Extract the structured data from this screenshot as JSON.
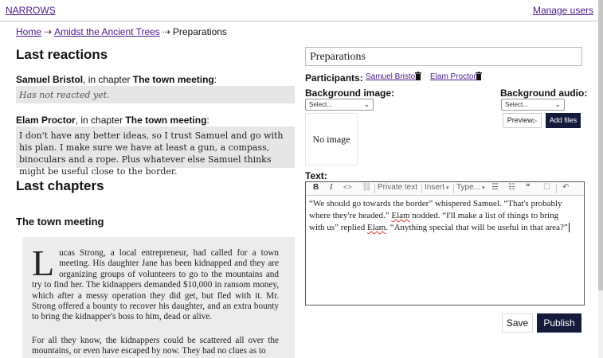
{
  "topbar": {
    "brand": "NARROWS",
    "manage": "Manage users"
  },
  "breadcrumb": {
    "home": "Home",
    "sep": "⇢",
    "story": "Amidst the Ancient Trees",
    "current": "Preparations"
  },
  "reactions": {
    "heading": "Last reactions",
    "items": [
      {
        "name": "Samuel Bristol",
        "mid": ", in chapter ",
        "chapter": "The town meeting",
        "colon": ":",
        "text": "Has not reacted yet."
      },
      {
        "name": "Elam Proctor",
        "mid": ", in chapter ",
        "chapter": "The town meeting",
        "colon": ":",
        "text": "I don't have any better ideas, so I trust Samuel and go with his plan. I make sure we have at least a gun, a compass, binoculars and a rope. Plus whatever else Samuel thinks might be useful close to the border."
      }
    ]
  },
  "chapters": {
    "heading": "Last chapters",
    "title": "The town meeting",
    "dropcap": "L",
    "p1": "ucas Strong, a local entrepreneur, had called for a town meeting. His daughter Jane has been kidnapped and they are organizing groups of volunteers to go to the mountains and try to find her. The kidnappers demanded $10,000 in ransom money, which after a messy operation they did get, but fled with it. Mr. Strong offered a bounty to recover his daughter, and an extra bounty to bring the kidnapper's boss to him, dead or alive.",
    "p2": "For all they know, the kidnappers could be scattered all over the mountains, or even have escaped by now. They had no clues as to"
  },
  "editor": {
    "title_value": "Preparations",
    "participants_label": "Participants:",
    "participants": [
      "Samuel Bristol",
      "Elam Proctor"
    ],
    "bg_image_label": "Background image:",
    "bg_image_select": "Select...",
    "no_image": "No image",
    "bg_audio_label": "Background audio:",
    "bg_audio_select": "Select...",
    "preview_label": "Preview",
    "add_files_label": "Add files",
    "text_label": "Text:",
    "toolbar": {
      "bold": "B",
      "italic": "I",
      "code": "<>",
      "link": "⛓",
      "private": "Private text",
      "insert": "Insert",
      "type": "Type...",
      "bullets": "☰",
      "numbers": "☷",
      "quote": "❝",
      "table": "☐",
      "undo": "↶"
    },
    "text_a": "“We should go towards the border” whispered Samuel. “That's probably where they're headed.” ",
    "elam1": "Elam",
    "text_b": " nodded. “I'll make a list of things to bring with us” replied ",
    "elam2": "Elam",
    "text_c": ". “Anything special that will be useful in that area?”",
    "save_label": "Save",
    "publish_label": "Publish"
  }
}
